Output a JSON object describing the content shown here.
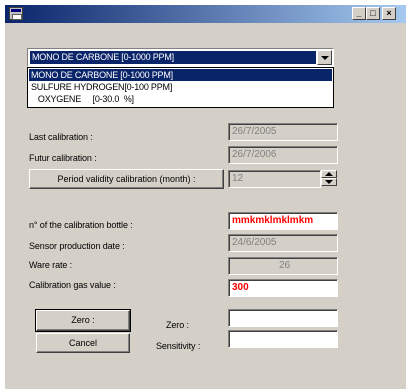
{
  "titlebar": {
    "minimize_label": "_",
    "maximize_label": "□",
    "close_label": "×"
  },
  "gas_select": {
    "selected": "MONO DE CARBONE [0-1000 PPM]",
    "options": [
      "MONO DE CARBONE [0-1000 PPM]",
      "SULFURE HYDROGEN[0-100 PPM]",
      "   OXYGENE     [0-30.0  %]"
    ]
  },
  "calibration": {
    "last_label": "Last calibration :",
    "last_value": "26/7/2005",
    "futur_label": "Futur calibration :",
    "futur_value": "26/7/2006",
    "period_button": "Period validity calibration (month) :",
    "period_value": "12"
  },
  "bottle": {
    "bottle_label": "n° of the calibration bottle :",
    "bottle_value": "mmkmklmklmkm",
    "production_label": "Sensor production date :",
    "production_value": "24/6/2005",
    "ware_label": "Ware rate :",
    "ware_value": "26",
    "gas_value_label": "Calibration gas value :",
    "gas_value": "300"
  },
  "actions": {
    "zero_button": "Zero :",
    "cancel_button": "Cancel",
    "zero_label": "Zero :",
    "sensitivity_label": "Sensitivity :",
    "zero_value": "",
    "sensitivity_value": ""
  },
  "colors": {
    "title_active": "#0a246a",
    "face": "#d4d0c8",
    "highlight_text": "#ff0000"
  }
}
